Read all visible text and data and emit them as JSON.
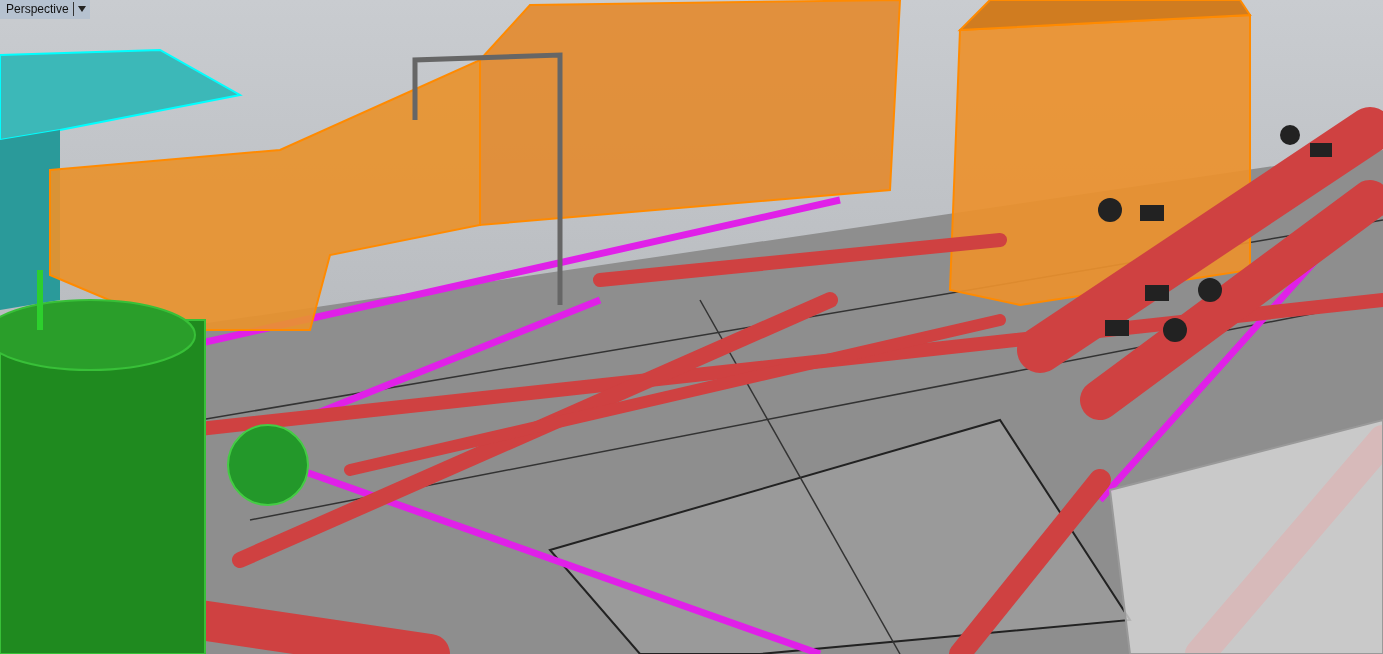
{
  "viewport": {
    "title": "Perspective"
  }
}
